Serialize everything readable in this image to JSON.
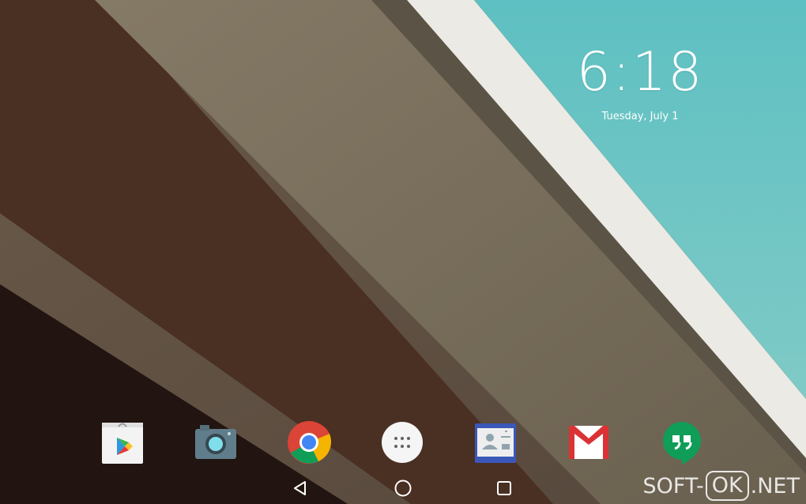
{
  "lockscreen": {
    "time": "6:18",
    "date": "Tuesday, July 1"
  },
  "dock": {
    "apps": [
      {
        "name": "Play Store",
        "icon": "play-store-icon"
      },
      {
        "name": "Camera",
        "icon": "camera-icon"
      },
      {
        "name": "Chrome",
        "icon": "chrome-icon"
      },
      {
        "name": "All Apps",
        "icon": "app-drawer-icon"
      },
      {
        "name": "Contacts",
        "icon": "contacts-icon"
      },
      {
        "name": "Gmail",
        "icon": "gmail-icon"
      },
      {
        "name": "Hangouts",
        "icon": "hangouts-icon"
      }
    ]
  },
  "navbar": {
    "buttons": [
      "back-icon",
      "home-icon",
      "recents-icon"
    ]
  },
  "watermark": {
    "part1": "SOFT-",
    "part2": "OK",
    "part3": ".NET"
  },
  "colors": {
    "sky": "#6fc4c2",
    "beam_light": "#ecebe5",
    "beam_mid": "#736a5b",
    "beam_dark": "#4a3024",
    "shadow": "#271914"
  }
}
